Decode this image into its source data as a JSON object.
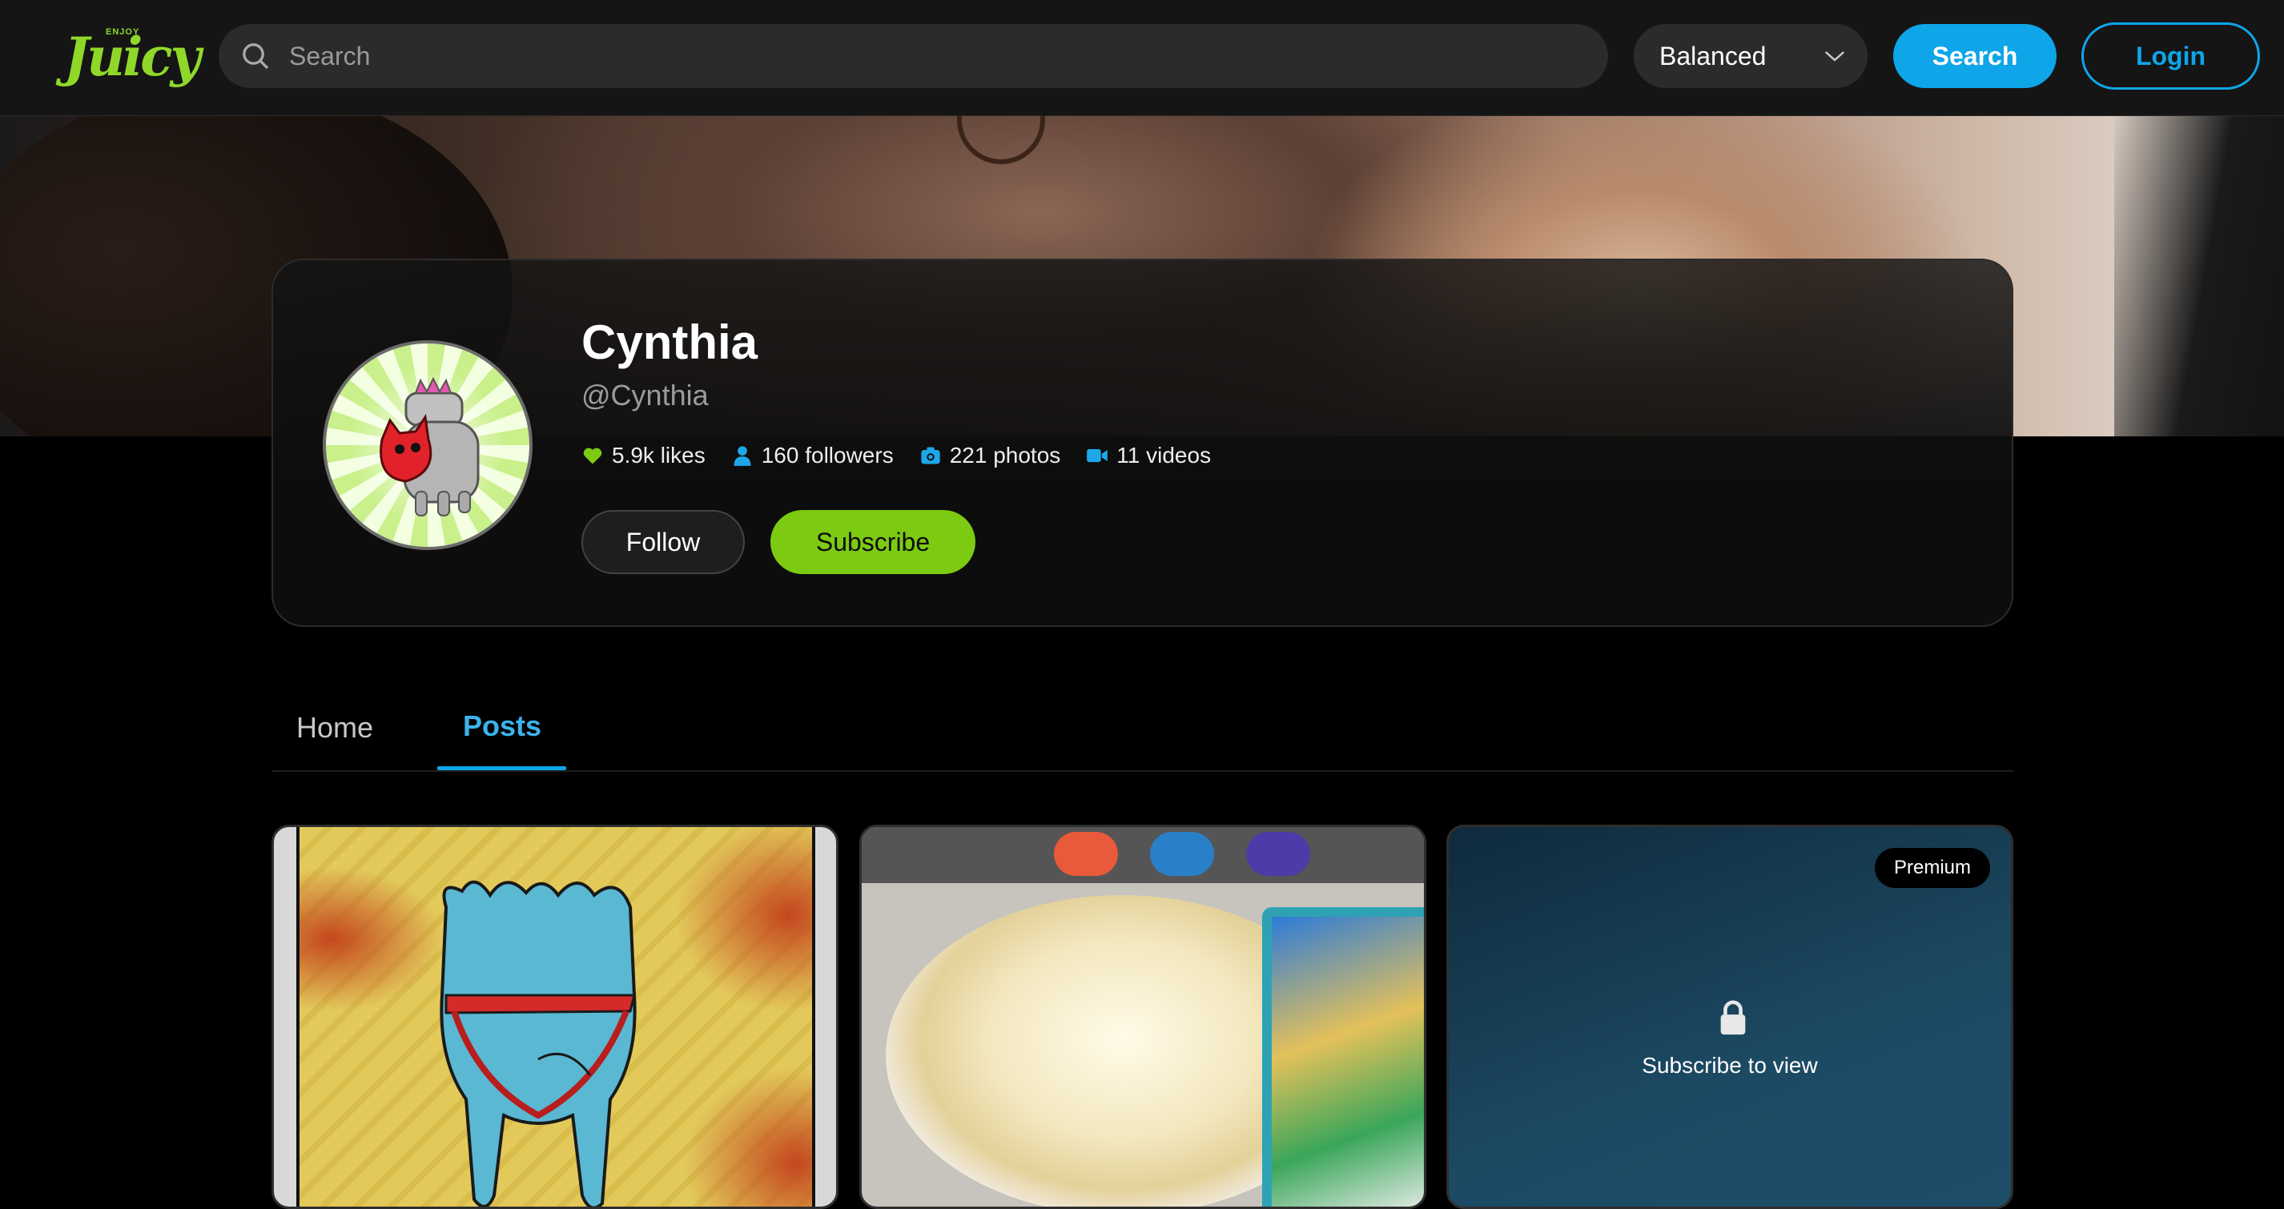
{
  "header": {
    "logo_small": "ENJOY",
    "logo_word": "Juicy",
    "search_placeholder": "Search",
    "sort_value": "Balanced",
    "search_button": "Search",
    "login_button": "Login"
  },
  "profile": {
    "name": "Cynthia",
    "handle": "@Cynthia",
    "stats": {
      "likes": "5.9k likes",
      "followers": "160 followers",
      "photos": "221 photos",
      "videos": "11 videos"
    },
    "follow_button": "Follow",
    "subscribe_button": "Subscribe"
  },
  "tabs": {
    "home": "Home",
    "posts": "Posts",
    "active": "Posts"
  },
  "posts": [
    {
      "id": "post-1",
      "locked": false
    },
    {
      "id": "post-2",
      "locked": false
    },
    {
      "id": "post-3",
      "locked": true,
      "badge": "Premium",
      "lock_text": "Subscribe to view"
    }
  ],
  "colors": {
    "accent_blue": "#0ea5e9",
    "brand_green": "#7ccb12",
    "background": "#000000"
  },
  "icons": {
    "search": "search-icon",
    "chevron": "chevron-down-icon",
    "likes": "heart-icon",
    "followers": "person-icon",
    "photos": "camera-icon",
    "videos": "video-icon",
    "lock": "lock-icon"
  }
}
